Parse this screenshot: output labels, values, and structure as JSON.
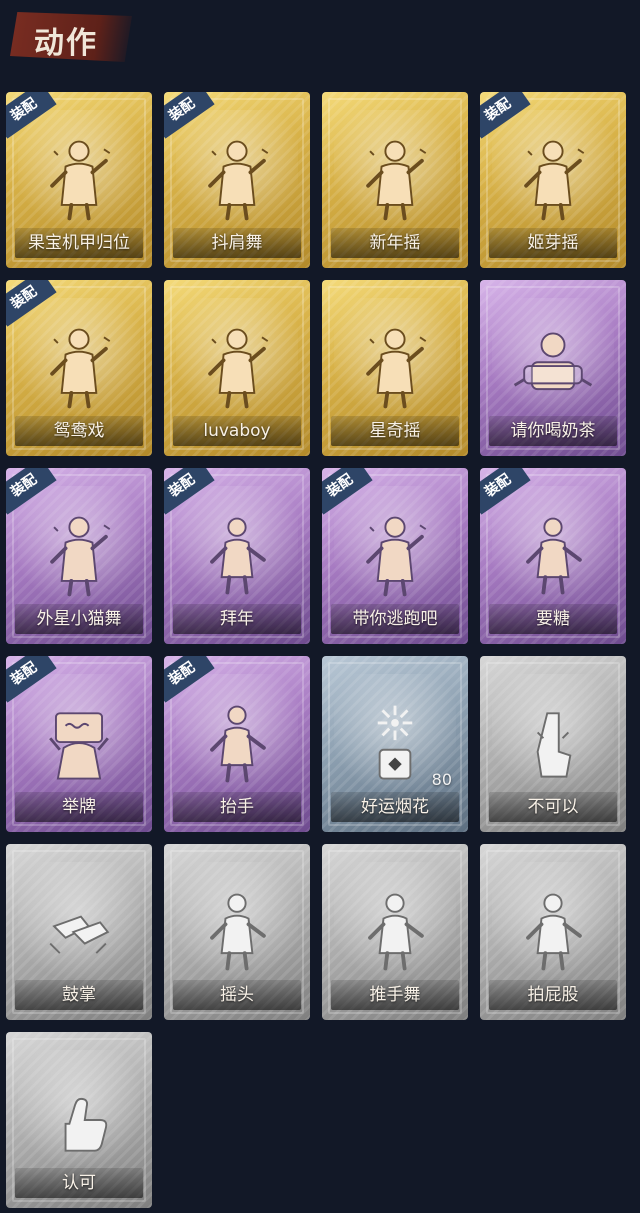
{
  "section": {
    "title": "动作"
  },
  "cards": [
    {
      "label": "果宝机甲归位",
      "theme": "gold",
      "icon": "dance-figure-icon",
      "badge": "装配"
    },
    {
      "label": "抖肩舞",
      "theme": "gold",
      "icon": "dance-figure-icon",
      "badge": "装配"
    },
    {
      "label": "新年摇",
      "theme": "gold",
      "icon": "dance-figure-icon",
      "badge": ""
    },
    {
      "label": "姬芽摇",
      "theme": "gold",
      "icon": "dance-figure-icon",
      "badge": "装配"
    },
    {
      "label": "鸳鸯戏",
      "theme": "gold",
      "icon": "dance-figure-icon",
      "badge": "装配"
    },
    {
      "label": "luvaboy",
      "theme": "gold",
      "icon": "dance-figure-icon",
      "badge": ""
    },
    {
      "label": "星奇摇",
      "theme": "gold",
      "icon": "dance-figure-icon",
      "badge": ""
    },
    {
      "label": "请你喝奶茶",
      "theme": "purple",
      "icon": "milk-tea-icon",
      "badge": ""
    },
    {
      "label": "外星小猫舞",
      "theme": "purple",
      "icon": "dance-figure-icon",
      "badge": "装配"
    },
    {
      "label": "拜年",
      "theme": "purple",
      "icon": "bow-figure-icon",
      "badge": "装配"
    },
    {
      "label": "带你逃跑吧",
      "theme": "purple",
      "icon": "dance-figure-icon",
      "badge": "装配"
    },
    {
      "label": "要糖",
      "theme": "purple",
      "icon": "reach-figure-icon",
      "badge": "装配"
    },
    {
      "label": "举牌",
      "theme": "purple",
      "icon": "sign-board-icon",
      "badge": "装配"
    },
    {
      "label": "抬手",
      "theme": "purple",
      "icon": "raise-hand-icon",
      "badge": "装配"
    },
    {
      "label": "好运烟花",
      "theme": "blue",
      "icon": "firework-icon",
      "badge": "",
      "count": "80"
    },
    {
      "label": "不可以",
      "theme": "silver",
      "icon": "finger-icon",
      "badge": ""
    },
    {
      "label": "鼓掌",
      "theme": "silver",
      "icon": "clap-icon",
      "badge": ""
    },
    {
      "label": "摇头",
      "theme": "silver",
      "icon": "shake-head-icon",
      "badge": ""
    },
    {
      "label": "推手舞",
      "theme": "silver",
      "icon": "push-hand-icon",
      "badge": ""
    },
    {
      "label": "拍屁股",
      "theme": "silver",
      "icon": "pat-icon",
      "badge": ""
    },
    {
      "label": "认可",
      "theme": "silver",
      "icon": "thumbs-up-icon",
      "badge": ""
    }
  ]
}
